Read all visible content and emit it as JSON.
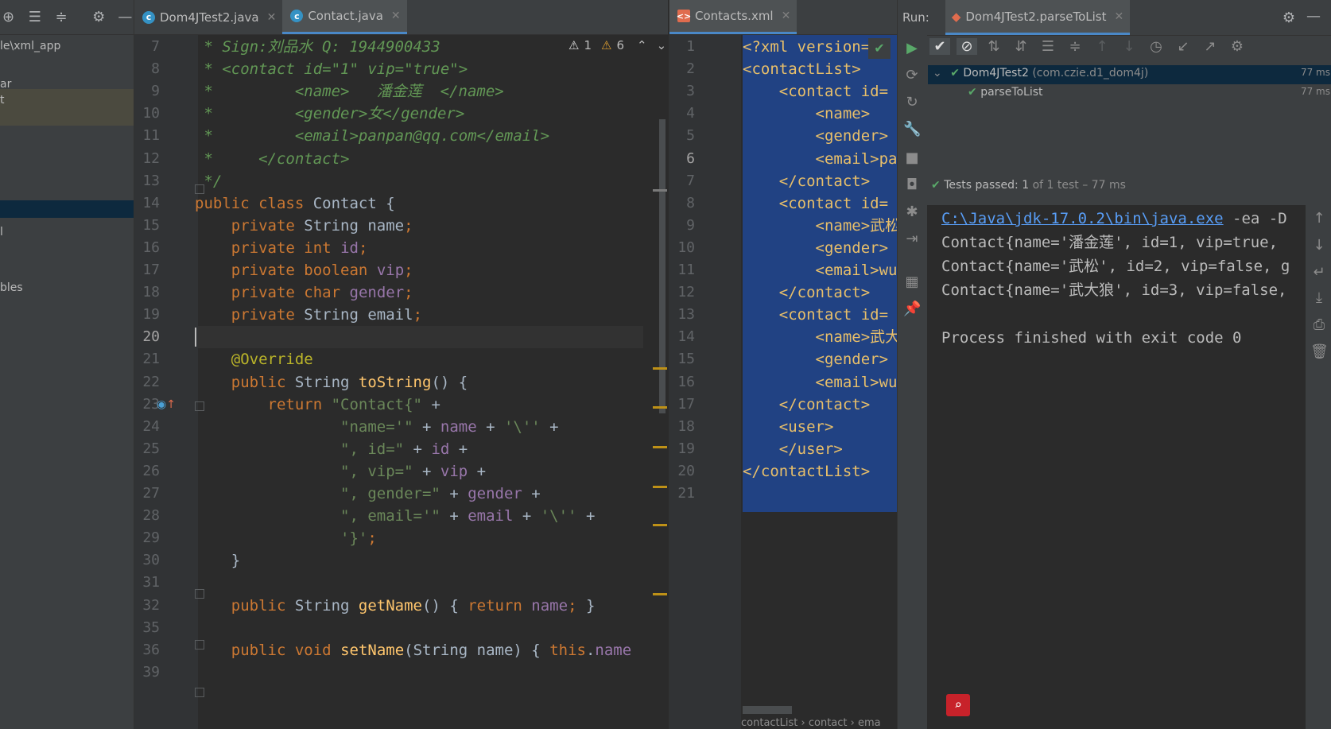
{
  "project": {
    "path_label": "le\\xml_app",
    "rows": [
      "ar",
      "t",
      "l",
      "bles"
    ]
  },
  "editor1": {
    "tabs": [
      {
        "label": "Dom4JTest2.java",
        "icon": "c"
      },
      {
        "label": "Contact.java",
        "icon": "c"
      }
    ],
    "warnings": {
      "errors": "1",
      "warns": "6"
    },
    "line_numbers": [
      "7",
      "8",
      "9",
      "10",
      "11",
      "12",
      "13",
      "14",
      "15",
      "16",
      "17",
      "18",
      "19",
      "20",
      "21",
      "22",
      "23",
      "24",
      "25",
      "26",
      "27",
      "28",
      "29",
      "30",
      "31",
      "32",
      "35",
      "36",
      "39"
    ],
    "code": [
      " * Sign:刘品水 Q: 1944900433",
      " * <contact id=\"1\" vip=\"true\">",
      " *         <name>   潘金莲  </name>",
      " *         <gender>女</gender>",
      " *         <email>panpan@qq.com</email>",
      " *     </contact>",
      " */",
      "public class Contact {",
      "    private String name;",
      "    private int id;",
      "    private boolean vip;",
      "    private char gender;",
      "    private String email;",
      "",
      "    @Override",
      "    public String toString() {",
      "        return \"Contact{\" +",
      "                \"name='\" + name + '\\'' +",
      "                \", id=\" + id +",
      "                \", vip=\" + vip +",
      "                \", gender=\" + gender +",
      "                \", email='\" + email + '\\'' +",
      "                '}';",
      "    }",
      "",
      "    public String getName() { return name; }",
      "",
      "    public void setName(String name) { this.name",
      ""
    ]
  },
  "editor2": {
    "tab": "Contacts.xml",
    "line_numbers": [
      "1",
      "2",
      "3",
      "4",
      "5",
      "6",
      "7",
      "8",
      "9",
      "10",
      "11",
      "12",
      "13",
      "14",
      "15",
      "16",
      "17",
      "18",
      "19",
      "20",
      "21"
    ],
    "code": [
      "<?xml version=",
      "<contactList>",
      "    <contact id=",
      "        <name>",
      "        <gender>",
      "        <email>pa",
      "    </contact>",
      "    <contact id=",
      "        <name>武松",
      "        <gender>",
      "        <email>wu",
      "    </contact>",
      "    <contact id=",
      "        <name>武大",
      "        <gender>",
      "        <email>wu",
      "    </contact>",
      "    <user>",
      "    </user>",
      "</contactList>",
      ""
    ],
    "breadcrumb": [
      "contactList",
      "contact",
      "ema"
    ]
  },
  "run": {
    "label": "Run:",
    "tab": "Dom4JTest2.parseToList",
    "tree": [
      {
        "name": "Dom4JTest2",
        "pkg": "(com.czie.d1_dom4j)",
        "time": "77 ms"
      },
      {
        "name": "parseToList",
        "pkg": "",
        "time": "77 ms"
      }
    ],
    "status_bold": "Tests passed: 1",
    "status_rest": "of 1 test – 77 ms",
    "console": {
      "java_path": "C:\\Java\\jdk-17.0.2\\bin\\java.exe",
      "java_args": " -ea -D",
      "lines": [
        "Contact{name='潘金莲', id=1, vip=true, ",
        "Contact{name='武松', id=2, vip=false, g",
        "Contact{name='武大狼', id=3, vip=false,",
        "",
        "Process finished with exit code 0"
      ]
    }
  },
  "colors": {
    "accent": "#4a88c7",
    "selection": "#214283",
    "pass": "#499c54"
  }
}
